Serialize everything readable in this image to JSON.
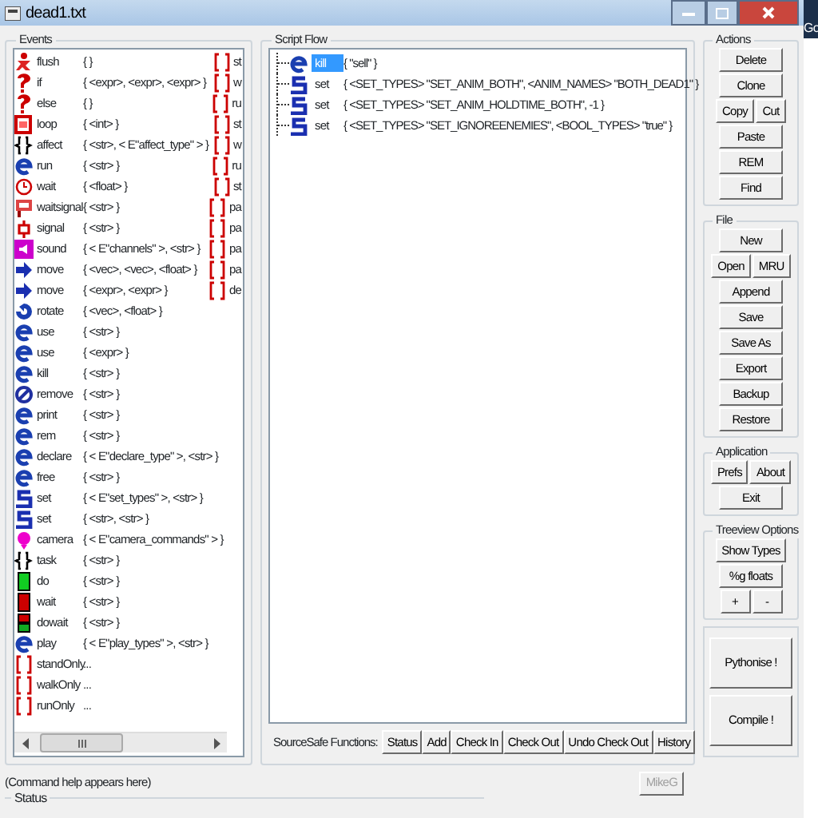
{
  "window": {
    "title": "dead1.txt"
  },
  "desktop": {
    "label": "Go"
  },
  "events": {
    "title": "Events",
    "items": [
      {
        "kind": "flush",
        "name": "flush",
        "args": "{ }",
        "column_3": "st"
      },
      {
        "kind": "question",
        "name": "if",
        "args": "{ <expr>, <expr>, <expr> }",
        "column_3": "w"
      },
      {
        "kind": "question",
        "name": "else",
        "args": "{ }",
        "column_3": "ru"
      },
      {
        "kind": "loop",
        "name": "loop",
        "args": "{ <int> }",
        "column_3": "st"
      },
      {
        "kind": "braces",
        "name": "affect",
        "args": "{ <str>, < E\"affect_type\" > }",
        "column_3": "w"
      },
      {
        "kind": "e",
        "name": "run",
        "args": "{ <str> }",
        "column_3": "ru"
      },
      {
        "kind": "clock",
        "name": "wait",
        "args": "{ <float> }",
        "column_3": "st"
      },
      {
        "kind": "flag",
        "name": "waitsignal",
        "args": "{ <str> }",
        "column_3": "pa"
      },
      {
        "kind": "signal",
        "name": "signal",
        "args": "{ <str> }",
        "column_3": "pa"
      },
      {
        "kind": "sound",
        "name": "sound",
        "args": "{ < E\"channels\" >, <str> }",
        "column_3": "pa"
      },
      {
        "kind": "arrow",
        "name": "move",
        "args": "{ <vec>, <vec>, <float> }",
        "column_3": "pa"
      },
      {
        "kind": "arrow",
        "name": "move",
        "args": "{ <expr>, <expr> }",
        "column_3": "de"
      },
      {
        "kind": "rotate",
        "name": "rotate",
        "args": "{ <vec>, <float> }"
      },
      {
        "kind": "e",
        "name": "use",
        "args": "{ <str> }"
      },
      {
        "kind": "e",
        "name": "use",
        "args": "{ <expr> }"
      },
      {
        "kind": "e",
        "name": "kill",
        "args": "{ <str> }"
      },
      {
        "kind": "remove",
        "name": "remove",
        "args": "{ <str> }"
      },
      {
        "kind": "e",
        "name": "print",
        "args": "{ <str> }"
      },
      {
        "kind": "e",
        "name": "rem",
        "args": "{ <str> }"
      },
      {
        "kind": "e",
        "name": "declare",
        "args": "{ < E\"declare_type\" >, <str> }"
      },
      {
        "kind": "e",
        "name": "free",
        "args": "{ <str> }"
      },
      {
        "kind": "s",
        "name": "set",
        "args": "{ < E\"set_types\" >, <str> }"
      },
      {
        "kind": "s",
        "name": "set",
        "args": "{ <str>, <str> }"
      },
      {
        "kind": "camera",
        "name": "camera",
        "args": "{ < E\"camera_commands\" > }"
      },
      {
        "kind": "braces",
        "name": "task",
        "args": "{ <str> }"
      },
      {
        "kind": "go",
        "name": "do",
        "args": "{ <str> }"
      },
      {
        "kind": "stop",
        "name": "wait",
        "args": "{ <str> }"
      },
      {
        "kind": "dowait",
        "name": "dowait",
        "args": "{ <str> }"
      },
      {
        "kind": "e",
        "name": "play",
        "args": "{ < E\"play_types\" >, <str> }"
      },
      {
        "kind": "bracket",
        "name": "standOnly",
        "args": "..."
      },
      {
        "kind": "bracket",
        "name": "walkOnly",
        "args": "..."
      },
      {
        "kind": "bracket",
        "name": "runOnly",
        "args": "..."
      }
    ]
  },
  "script_flow": {
    "title": "Script Flow",
    "items": [
      {
        "kind": "e",
        "name": "kill",
        "args": "{ \"sell\" }",
        "selected": true
      },
      {
        "kind": "s",
        "name": "set",
        "args": "{ <SET_TYPES> \"SET_ANIM_BOTH\", <ANIM_NAMES> \"BOTH_DEAD1\" }",
        "selected": false
      },
      {
        "kind": "s",
        "name": "set",
        "args": "{ <SET_TYPES> \"SET_ANIM_HOLDTIME_BOTH\", -1 }",
        "selected": false
      },
      {
        "kind": "s",
        "name": "set",
        "args": "{ <SET_TYPES> \"SET_IGNOREENEMIES\", <BOOL_TYPES> \"true\" }",
        "selected": false
      }
    ],
    "sourcesafe": {
      "label": "SourceSafe Functions:",
      "buttons": [
        "Status",
        "Add",
        "Check In",
        "Check Out",
        "Undo Check Out",
        "History"
      ]
    }
  },
  "panels": [
    {
      "title": "Actions",
      "rows": [
        [
          "Delete"
        ],
        [
          "Clone"
        ],
        [
          "Copy",
          "Cut"
        ],
        [
          "Paste"
        ],
        [
          "REM"
        ],
        [
          "Find"
        ]
      ]
    },
    {
      "title": "File",
      "rows": [
        [
          "New"
        ],
        [
          "Open",
          "MRU"
        ],
        [
          "Append"
        ],
        [
          "Save"
        ],
        [
          "Save As"
        ],
        [
          "Export"
        ],
        [
          "Backup"
        ],
        [
          "Restore"
        ]
      ]
    },
    {
      "title": "Application",
      "rows": [
        [
          "Prefs",
          "About"
        ],
        [
          "Exit"
        ]
      ]
    },
    {
      "title": "Treeview Options",
      "rows": [
        [
          "Show Types"
        ],
        [
          "%g floats"
        ],
        [
          "+",
          "-"
        ]
      ]
    }
  ],
  "big_buttons": [
    "Pythonise !",
    "Compile !"
  ],
  "command_help": "(Command help appears here)",
  "user_button": {
    "label": "MikeG",
    "disabled": true
  },
  "status": {
    "title": "Status"
  }
}
